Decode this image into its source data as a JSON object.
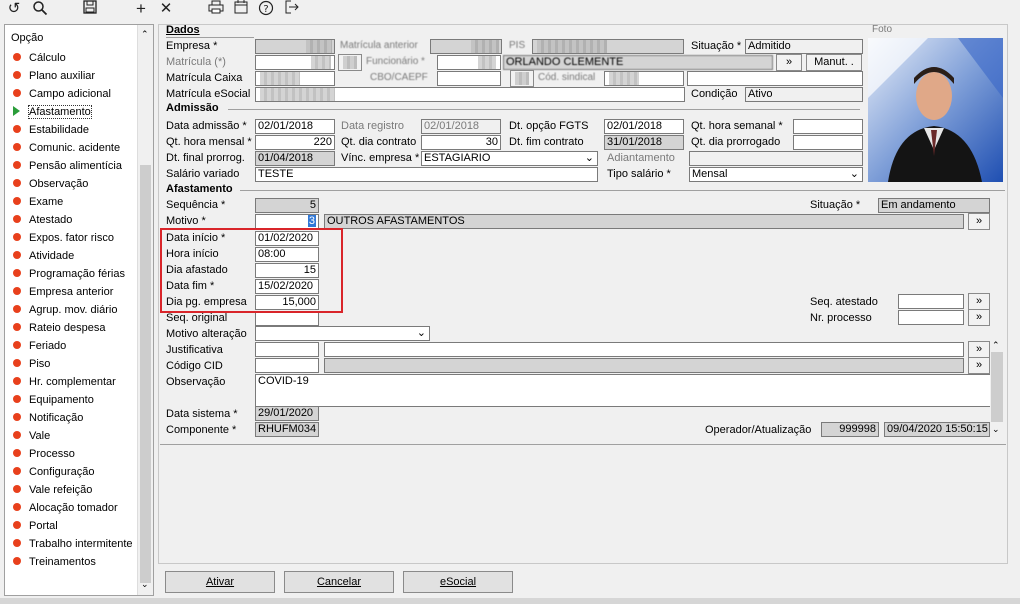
{
  "toolbar": {
    "icons": [
      "undo-icon",
      "search-icon",
      "save-icon",
      "add-icon",
      "close-icon",
      "print-icon",
      "calendar-icon",
      "help-icon",
      "exit-icon"
    ]
  },
  "sidebar": {
    "header": "Opção",
    "items": [
      {
        "label": "Cálculo"
      },
      {
        "label": "Plano auxiliar"
      },
      {
        "label": "Campo adicional"
      },
      {
        "label": "Afastamento"
      },
      {
        "label": "Estabilidade"
      },
      {
        "label": "Comunic. acidente"
      },
      {
        "label": "Pensão alimentícia"
      },
      {
        "label": "Observação"
      },
      {
        "label": "Exame"
      },
      {
        "label": "Atestado"
      },
      {
        "label": "Expos. fator risco"
      },
      {
        "label": "Atividade"
      },
      {
        "label": "Programação férias"
      },
      {
        "label": "Empresa anterior"
      },
      {
        "label": "Agrup. mov. diário"
      },
      {
        "label": "Rateio despesa"
      },
      {
        "label": "Feriado"
      },
      {
        "label": "Piso"
      },
      {
        "label": "Hr. complementar"
      },
      {
        "label": "Equipamento"
      },
      {
        "label": "Notificação"
      },
      {
        "label": "Vale"
      },
      {
        "label": "Processo"
      },
      {
        "label": "Configuração"
      },
      {
        "label": "Vale refeição"
      },
      {
        "label": "Alocação tomador"
      },
      {
        "label": "Portal"
      },
      {
        "label": "Trabalho intermitente"
      },
      {
        "label": "Treinamentos"
      }
    ]
  },
  "dados": {
    "title": "Dados",
    "empresa_label": "Empresa *",
    "matricula_label": "Matrícula (*)",
    "matricula_caixa_label": "Matrícula Caixa",
    "matricula_esocial_label": "Matrícula eSocial",
    "matricula_anterior_label": "Matrícula anterior",
    "funcionario_label": "Funcionário *",
    "pis_label": "PIS",
    "cbo_label": "CBO/CAEPF",
    "cod_label": "Cód. sindical",
    "funcionario_name": "ORLANDO CLEMENTE",
    "situacao_label": "Situação *",
    "situacao_value": "Admitido",
    "condicao_label": "Condição",
    "condicao_value": "Ativo",
    "manut_label": "Manut. .",
    "foto_label": "Foto"
  },
  "admissao": {
    "title": "Admissão",
    "data_admissao_label": "Data admissão *",
    "data_admissao": "02/01/2018",
    "data_registro_label": "Data registro",
    "data_registro": "02/01/2018",
    "dt_opcao_fgts_label": "Dt. opção FGTS",
    "dt_opcao_fgts": "02/01/2018",
    "qt_hora_semanal_label": "Qt. hora semanal *",
    "qt_hora_mensal_label": "Qt. hora mensal *",
    "qt_hora_mensal": "220",
    "qt_dia_contrato_label": "Qt. dia contrato",
    "qt_dia_contrato": "30",
    "dt_fim_contrato_label": "Dt. fim contrato",
    "dt_fim_contrato": "31/01/2018",
    "qt_dia_prorrogado_label": "Qt. dia prorrogado",
    "dt_final_prorrog_label": "Dt. final prorrog.",
    "dt_final_prorrog": "01/04/2018",
    "vinc_empresa_label": "Vínc. empresa *",
    "vinc_empresa": "ESTAGIARIO",
    "adiantamento_label": "Adiantamento",
    "salario_variado_label": "Salário variado",
    "salario_variado": "TESTE",
    "tipo_salario_label": "Tipo salário *",
    "tipo_salario": "Mensal"
  },
  "afastamento": {
    "title": "Afastamento",
    "sequencia_label": "Sequência *",
    "sequencia": "5",
    "situacao_label": "Situação *",
    "situacao": "Em andamento",
    "motivo_label": "Motivo *",
    "motivo_code": "3",
    "motivo_desc": "OUTROS AFASTAMENTOS",
    "data_inicio_label": "Data início *",
    "data_inicio": "01/02/2020",
    "hora_inicio_label": "Hora início",
    "hora_inicio": "08:00",
    "dia_afastado_label": "Dia afastado",
    "dia_afastado": "15",
    "data_fim_label": "Data fim *",
    "data_fim": "15/02/2020",
    "dia_pg_empresa_label": "Dia pg. empresa",
    "dia_pg_empresa": "15,000",
    "seq_original_label": "Seq. original",
    "seq_atestado_label": "Seq. atestado",
    "nr_processo_label": "Nr. processo",
    "motivo_alteracao_label": "Motivo alteração",
    "justificativa_label": "Justificativa",
    "codigo_cid_label": "Código CID",
    "observacao_label": "Observação",
    "observacao": "COVID-19",
    "data_sistema_label": "Data sistema *",
    "data_sistema": "29/01/2020",
    "componente_label": "Componente *",
    "componente": "RHUFM034",
    "operador_label": "Operador/Atualização",
    "operador": "999998",
    "atualizacao": "09/04/2020 15:50:15"
  },
  "footer": {
    "ativar": "Ativar",
    "cancelar": "Cancelar",
    "esocial": "eSocial"
  },
  "arrow_glyph": "»"
}
